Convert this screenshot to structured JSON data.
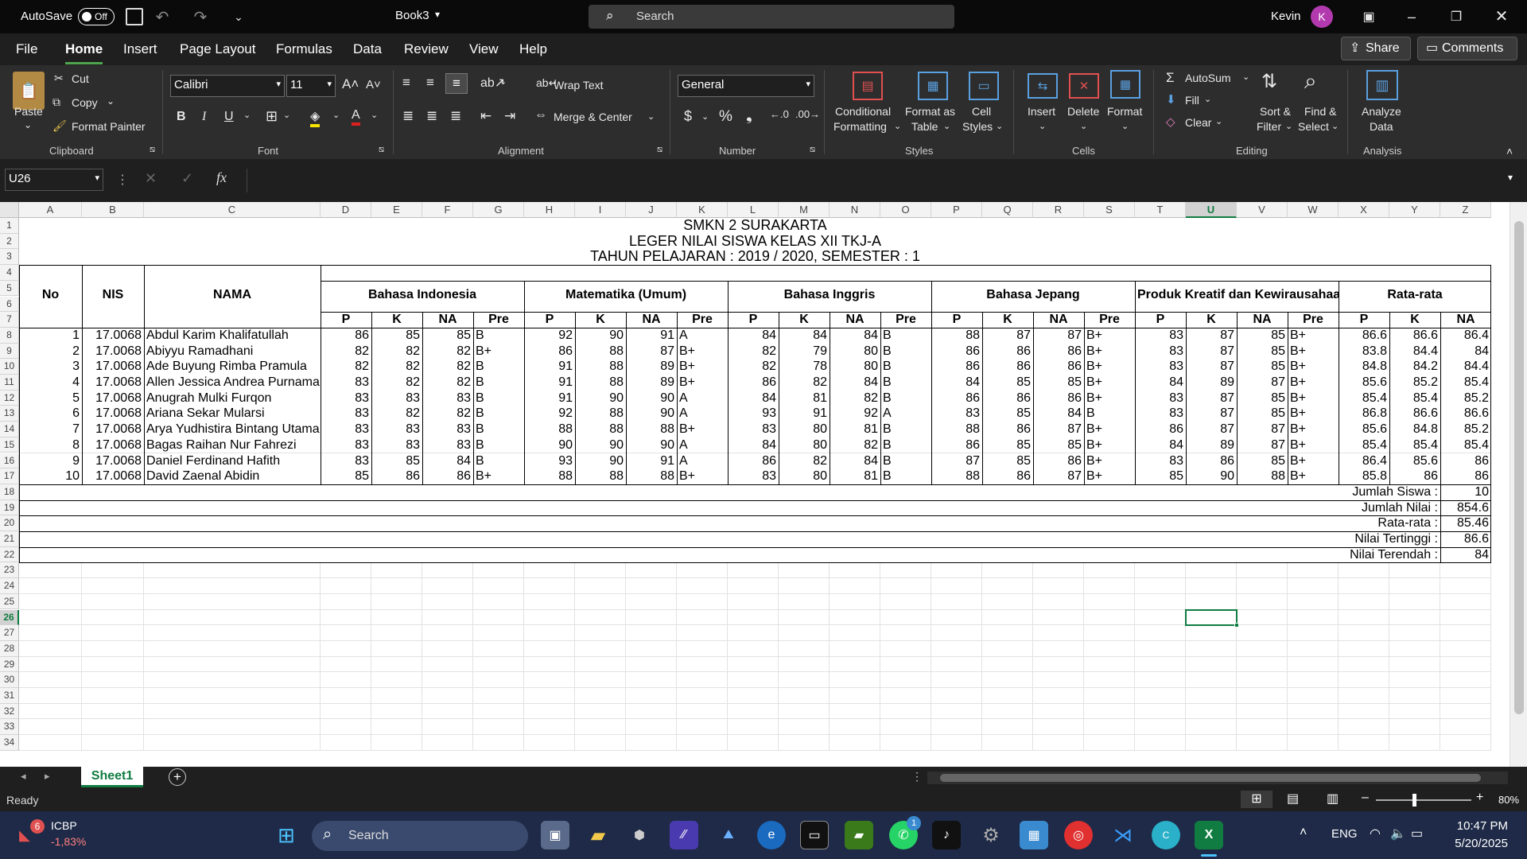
{
  "titlebar": {
    "autosave_label": "AutoSave",
    "autosave_state": "Off",
    "book_name": "Book3",
    "search_placeholder": "Search",
    "user_name": "Kevin",
    "user_initial": "K"
  },
  "menu": {
    "items": [
      "File",
      "Home",
      "Insert",
      "Page Layout",
      "Formulas",
      "Data",
      "Review",
      "View",
      "Help"
    ],
    "active": "Home",
    "share_label": "Share",
    "comments_label": "Comments"
  },
  "ribbon": {
    "clipboard": {
      "paste": "Paste",
      "cut": "Cut",
      "copy": "Copy",
      "format_painter": "Format Painter",
      "group": "Clipboard"
    },
    "font": {
      "name": "Calibri",
      "size": "11",
      "group": "Font"
    },
    "alignment": {
      "wrap_text": "Wrap Text",
      "merge_center": "Merge & Center",
      "group": "Alignment"
    },
    "number": {
      "format": "General",
      "group": "Number"
    },
    "styles": {
      "conditional": "Conditional",
      "conditional2": "Formatting",
      "format_as": "Format as",
      "format_as2": "Table",
      "cell": "Cell",
      "cell2": "Styles",
      "group": "Styles"
    },
    "cells": {
      "insert": "Insert",
      "delete": "Delete",
      "format": "Format",
      "group": "Cells"
    },
    "editing": {
      "autosum": "AutoSum",
      "fill": "Fill",
      "clear": "Clear",
      "sort": "Sort &",
      "sort2": "Filter",
      "find": "Find &",
      "find2": "Select",
      "group": "Editing"
    },
    "analysis": {
      "analyze": "Analyze",
      "analyze2": "Data",
      "group": "Analysis"
    }
  },
  "formula_bar": {
    "name_box": "U26",
    "fx": "fx",
    "value": ""
  },
  "grid": {
    "columns": [
      "A",
      "B",
      "C",
      "D",
      "E",
      "F",
      "G",
      "H",
      "I",
      "J",
      "K",
      "L",
      "M",
      "N",
      "O",
      "P",
      "Q",
      "R",
      "S",
      "T",
      "U",
      "V",
      "W",
      "X",
      "Y",
      "Z"
    ],
    "rows": [
      "1",
      "2",
      "3",
      "4",
      "5",
      "6",
      "7",
      "8",
      "9",
      "10",
      "11",
      "12",
      "13",
      "14",
      "15",
      "16",
      "17",
      "18",
      "19",
      "20",
      "21",
      "22",
      "23",
      "24",
      "25",
      "26",
      "27",
      "28",
      "29",
      "30",
      "31",
      "32",
      "33",
      "34"
    ],
    "selected_column": "U",
    "selected_row": "26"
  },
  "sheet": {
    "title1": "SMKN 2 SURAKARTA",
    "title2": "LEGER NILAI SISWA KELAS XII TKJ-A",
    "title3": "TAHUN PELAJARAN : 2019 / 2020, SEMESTER : 1",
    "hdr_no": "No",
    "hdr_nis": "NIS",
    "hdr_nama": "NAMA",
    "subjects": [
      "Bahasa Indonesia",
      "Matematika (Umum)",
      "Bahasa Inggris",
      "Bahasa Jepang",
      "Produk Kreatif dan Kewirausahaan",
      "Rata-rata"
    ],
    "sub_headers": [
      "P",
      "K",
      "NA",
      "Pre",
      "P",
      "K",
      "NA",
      "Pre",
      "P",
      "K",
      "NA",
      "Pre",
      "P",
      "K",
      "NA",
      "Pre",
      "P",
      "K",
      "NA",
      "Pre",
      "P",
      "K",
      "NA"
    ],
    "students": [
      [
        "1",
        "17.0068",
        "Abdul Karim Khalifatullah",
        "86",
        "85",
        "85",
        "B",
        "92",
        "90",
        "91",
        "A",
        "84",
        "84",
        "84",
        "B",
        "88",
        "87",
        "87",
        "B+",
        "83",
        "87",
        "85",
        "B+",
        "86.6",
        "86.6",
        "86.4"
      ],
      [
        "2",
        "17.0068",
        "Abiyyu Ramadhani",
        "82",
        "82",
        "82",
        "B+",
        "86",
        "88",
        "87",
        "B+",
        "82",
        "79",
        "80",
        "B",
        "86",
        "86",
        "86",
        "B+",
        "83",
        "87",
        "85",
        "B+",
        "83.8",
        "84.4",
        "84"
      ],
      [
        "3",
        "17.0068",
        "Ade Buyung Rimba Pramula",
        "82",
        "82",
        "82",
        "B",
        "91",
        "88",
        "89",
        "B+",
        "82",
        "78",
        "80",
        "B",
        "86",
        "86",
        "86",
        "B+",
        "83",
        "87",
        "85",
        "B+",
        "84.8",
        "84.2",
        "84.4"
      ],
      [
        "4",
        "17.0068",
        "Allen Jessica Andrea Purnama",
        "83",
        "82",
        "82",
        "B",
        "91",
        "88",
        "89",
        "B+",
        "86",
        "82",
        "84",
        "B",
        "84",
        "85",
        "85",
        "B+",
        "84",
        "89",
        "87",
        "B+",
        "85.6",
        "85.2",
        "85.4"
      ],
      [
        "5",
        "17.0068",
        "Anugrah Mulki Furqon",
        "83",
        "83",
        "83",
        "B",
        "91",
        "90",
        "90",
        "A",
        "84",
        "81",
        "82",
        "B",
        "86",
        "86",
        "86",
        "B+",
        "83",
        "87",
        "85",
        "B+",
        "85.4",
        "85.4",
        "85.2"
      ],
      [
        "6",
        "17.0068",
        "Ariana Sekar Mularsi",
        "83",
        "82",
        "82",
        "B",
        "92",
        "88",
        "90",
        "A",
        "93",
        "91",
        "92",
        "A",
        "83",
        "85",
        "84",
        "B",
        "83",
        "87",
        "85",
        "B+",
        "86.8",
        "86.6",
        "86.6"
      ],
      [
        "7",
        "17.0068",
        "Arya Yudhistira Bintang Utama",
        "83",
        "83",
        "83",
        "B",
        "88",
        "88",
        "88",
        "B+",
        "83",
        "80",
        "81",
        "B",
        "88",
        "86",
        "87",
        "B+",
        "86",
        "87",
        "87",
        "B+",
        "85.6",
        "84.8",
        "85.2"
      ],
      [
        "8",
        "17.0068",
        "Bagas Raihan Nur Fahrezi",
        "83",
        "83",
        "83",
        "B",
        "90",
        "90",
        "90",
        "A",
        "84",
        "80",
        "82",
        "B",
        "86",
        "85",
        "85",
        "B+",
        "84",
        "89",
        "87",
        "B+",
        "85.4",
        "85.4",
        "85.4"
      ],
      [
        "9",
        "17.0068",
        "Daniel Ferdinand Hafith",
        "83",
        "85",
        "84",
        "B",
        "93",
        "90",
        "91",
        "A",
        "86",
        "82",
        "84",
        "B",
        "87",
        "85",
        "86",
        "B+",
        "83",
        "86",
        "85",
        "B+",
        "86.4",
        "85.6",
        "86"
      ],
      [
        "10",
        "17.0068",
        "David Zaenal Abidin",
        "85",
        "86",
        "86",
        "B+",
        "88",
        "88",
        "88",
        "B+",
        "83",
        "80",
        "81",
        "B",
        "88",
        "86",
        "87",
        "B+",
        "85",
        "90",
        "88",
        "B+",
        "85.8",
        "86",
        "86"
      ]
    ],
    "summary": [
      {
        "label": "Jumlah Siswa :",
        "value": "10"
      },
      {
        "label": "Jumlah Nilai :",
        "value": "854.6"
      },
      {
        "label": "Rata-rata :",
        "value": "85.46"
      },
      {
        "label": "Nilai Tertinggi :",
        "value": "86.6"
      },
      {
        "label": "Nilai Terendah :",
        "value": "84"
      }
    ]
  },
  "tabs": {
    "sheet_name": "Sheet1"
  },
  "status": {
    "ready": "Ready",
    "zoom": "80%"
  },
  "taskbar": {
    "stock_name": "ICBP",
    "stock_change": "-1,83%",
    "stock_badge": "6",
    "search_label": "Search",
    "lang": "ENG",
    "time": "10:47 PM",
    "date": "5/20/2025",
    "whatsapp_badge": "1"
  },
  "colors": {
    "accent_green": "#107c41",
    "selection": "#217346",
    "taskbar_bg": "#1e2a47"
  }
}
